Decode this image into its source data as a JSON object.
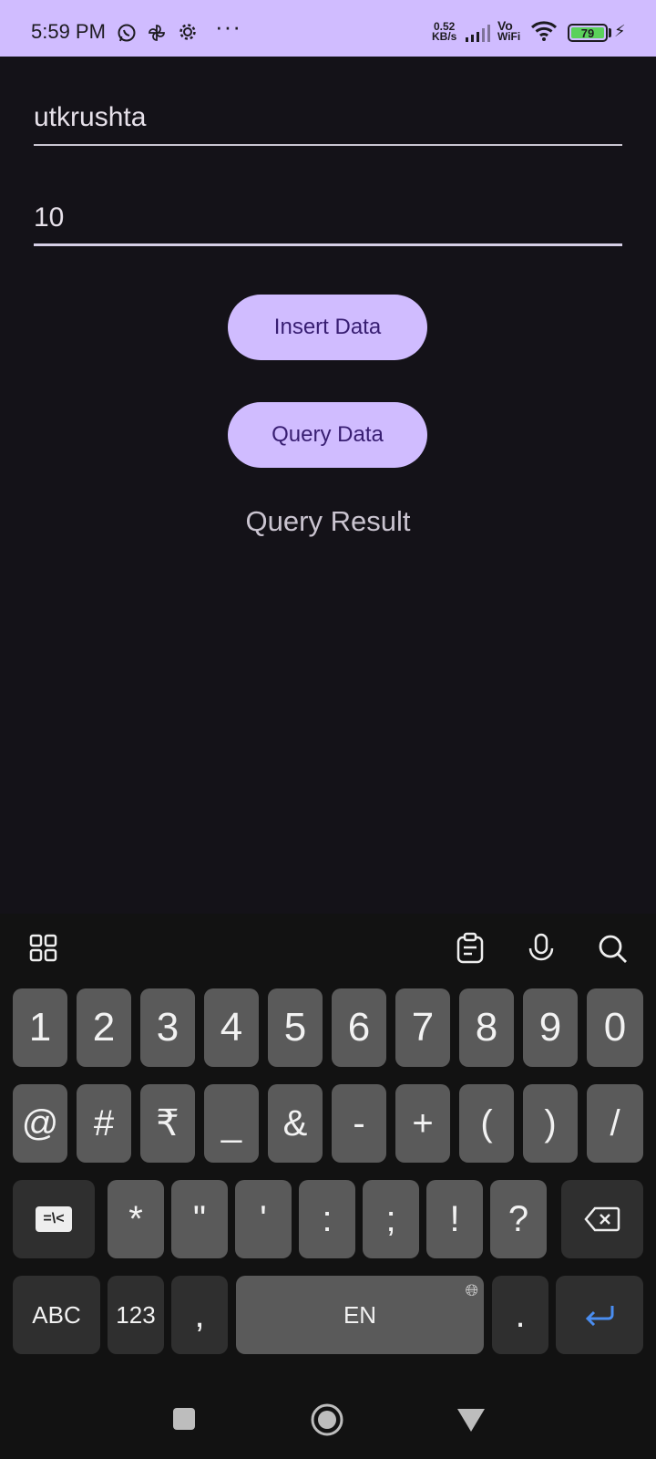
{
  "status_bar": {
    "time": "5:59 PM",
    "icons": [
      "whatsapp-icon",
      "pinwheel-icon",
      "settings-icon"
    ],
    "more": "···",
    "net_speed_value": "0.52",
    "net_speed_unit": "KB/s",
    "vo_label": "Vo",
    "wifi_label": "WiFi",
    "battery": "79",
    "colors": {
      "bar": "#D0BCFF",
      "battery_fill": "#5bd15b"
    }
  },
  "form": {
    "name_value": "utkrushta",
    "number_value": "10",
    "insert_label": "Insert Data",
    "query_label": "Query Data",
    "result_label": "Query Result"
  },
  "keyboard": {
    "toolbar": [
      "apps-grid-icon",
      "clipboard-icon",
      "microphone-icon",
      "search-icon"
    ],
    "row1": [
      "1",
      "2",
      "3",
      "4",
      "5",
      "6",
      "7",
      "8",
      "9",
      "0"
    ],
    "row2": [
      "@",
      "#",
      "₹",
      "_",
      "&",
      "-",
      "+",
      "(",
      ")",
      "/"
    ],
    "row3_toggle": "=\\<",
    "row3": [
      "*",
      "\"",
      "'",
      ":",
      ";",
      "!",
      "?"
    ],
    "row4": {
      "abc": "ABC",
      "num": "123",
      "comma": ",",
      "space": "EN",
      "period": "."
    }
  },
  "colors": {
    "background": "#141218",
    "accent": "#D0BCFF",
    "on_accent": "#381E72",
    "enter": "#4a8df0"
  }
}
